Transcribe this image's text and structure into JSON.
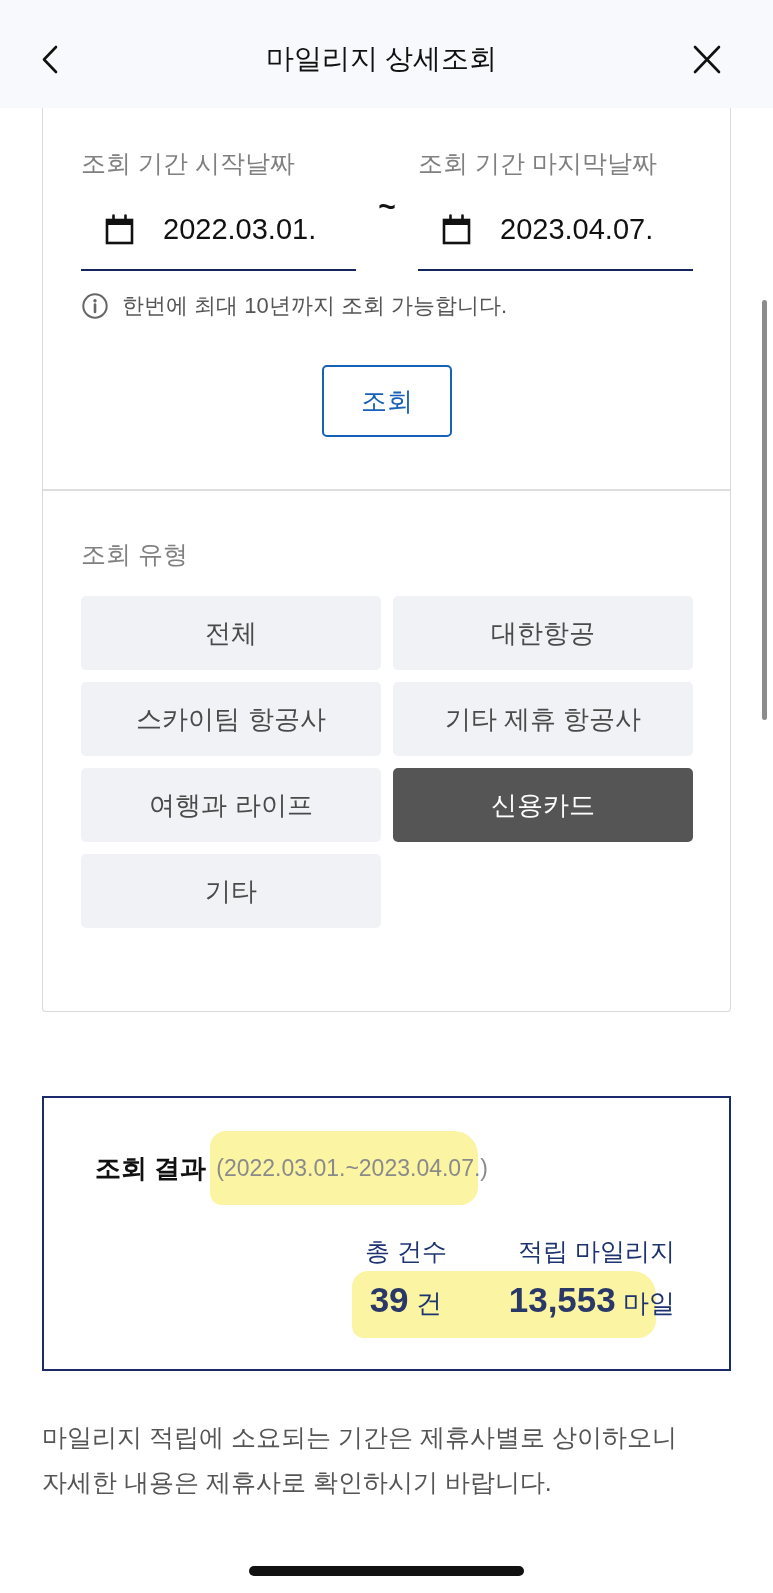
{
  "header": {
    "title": "마일리지 상세조회"
  },
  "period_search": {
    "date_fields": [
      {
        "label": "조회 기간 시작날짜",
        "value": "2022.03.01."
      },
      {
        "label": "조회 기간 마지막날짜",
        "value": "2023.04.07."
      }
    ],
    "separator": "~",
    "notice": "한번에 최대 10년까지 조회 가능합니다.",
    "search_button": "조회"
  },
  "type_filter": {
    "label": "조회 유형",
    "options": [
      {
        "label": "전체",
        "selected": false
      },
      {
        "label": "대한항공",
        "selected": false
      },
      {
        "label": "스카이팀 항공사",
        "selected": false
      },
      {
        "label": "기타 제휴 항공사",
        "selected": false
      },
      {
        "label": "여행과 라이프",
        "selected": false
      },
      {
        "label": "신용카드",
        "selected": true
      },
      {
        "label": "기타",
        "selected": false
      }
    ]
  },
  "result": {
    "title": "조회 결과",
    "period": {
      "text": "(2022.03.01.~2023.04.07.)",
      "highlighted": true
    },
    "totals": {
      "highlighted": true,
      "items": [
        {
          "label": "총 건수",
          "value": "39",
          "unit": "건"
        },
        {
          "label": "적립 마일리지",
          "value": "13,553",
          "unit": "마일"
        }
      ]
    }
  },
  "footnote": "마일리지 적립에 소요되는 기간은 제휴사별로 상이하오니 자세한 내용은 제휴사로 확인하시기 바랍니다."
}
